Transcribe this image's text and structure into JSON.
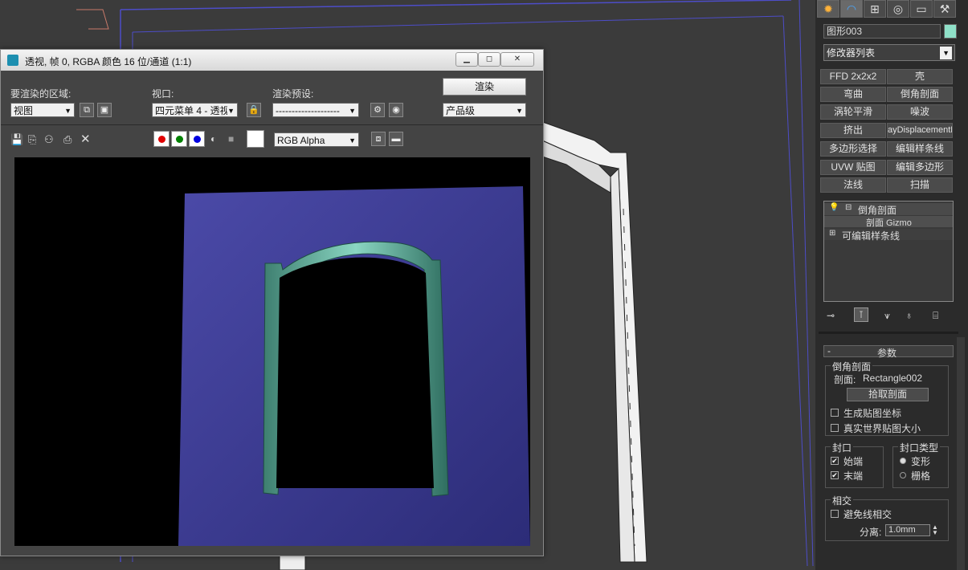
{
  "render_window": {
    "title": "透视, 帧 0, RGBA 颜色 16 位/通道 (1:1)",
    "area_label": "要渲染的区域:",
    "area_value": "视图",
    "viewport_label": "视口:",
    "viewport_value": "四元菜单 4 - 透视",
    "preset_label": "渲染预设:",
    "preset_value": "--------------------",
    "render_button": "渲染",
    "quality_value": "产品级",
    "channel_value": "RGB Alpha"
  },
  "command_panel": {
    "tabs": [
      "create-icon",
      "modify-icon",
      "hierarchy-icon",
      "motion-icon",
      "display-icon",
      "utilities-icon"
    ],
    "object_name": "图形003",
    "object_color": "#8fe0c8",
    "modifier_list": "修改器列表",
    "modifier_buttons": [
      "FFD 2x2x2",
      "壳",
      "弯曲",
      "倒角剖面",
      "涡轮平滑",
      "噪波",
      "挤出",
      "ayDisplacementM",
      "多边形选择",
      "编辑样条线",
      "UVW 贴图",
      "编辑多边形",
      "法线",
      "扫描"
    ],
    "stack": {
      "item1": "倒角剖面",
      "item1_sub": "剖面 Gizmo",
      "item2": "可编辑样条线"
    },
    "rollout_title": "参数",
    "bevel_group": "倒角剖面",
    "profile_label": "剖面:",
    "profile_value": "Rectangle002",
    "pick_button": "拾取剖面",
    "gen_mapping": "生成贴图坐标",
    "real_world": "真实世界贴图大小",
    "cap_group": "封口",
    "cap_start": "始端",
    "cap_end": "末端",
    "cap_type_group": "封口类型",
    "cap_morph": "变形",
    "cap_grid": "栅格",
    "intersect_group": "相交",
    "avoid_intersect": "避免线相交",
    "separation_label": "分离:",
    "separation_value": "1.0mm"
  }
}
